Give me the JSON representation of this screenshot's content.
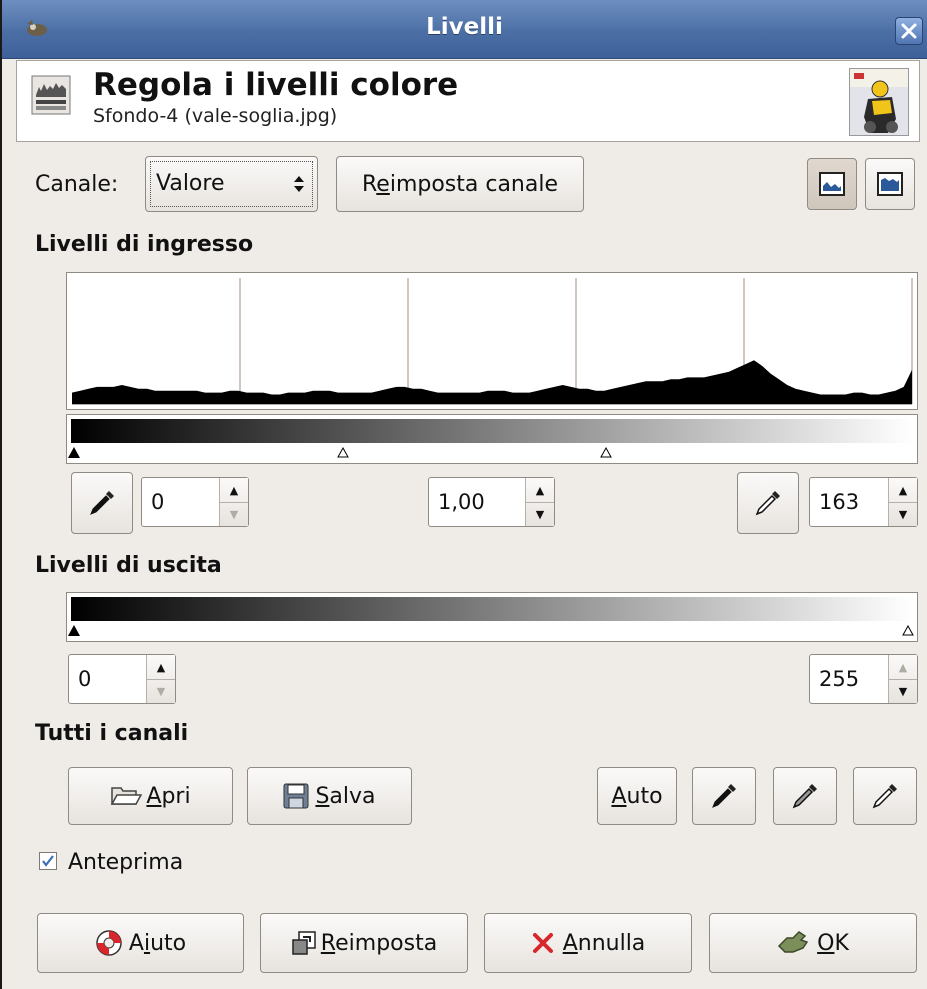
{
  "window": {
    "title": "Livelli"
  },
  "header": {
    "title": "Regola i livelli colore",
    "subtitle": "Sfondo-4 (vale-soglia.jpg)"
  },
  "channel": {
    "label": "Canale:",
    "value": "Valore",
    "reset_label_pre": "R",
    "reset_label_mnemonic": "e",
    "reset_label_post": "imposta canale"
  },
  "input_levels": {
    "title": "Livelli di ingresso",
    "low": "0",
    "gamma": "1,00",
    "high": "163"
  },
  "output_levels": {
    "title": "Livelli di uscita",
    "low": "0",
    "high": "255"
  },
  "all_channels": {
    "title": "Tutti i canali",
    "open_mnemonic": "A",
    "open_rest": "pri",
    "save_mnemonic": "S",
    "save_rest": "alva",
    "auto_mnemonic": "A",
    "auto_rest": "uto"
  },
  "preview": {
    "label": "Anteprima",
    "checked": true
  },
  "footer": {
    "help_pre": "A",
    "help_mnemonic": "i",
    "help_post": "uto",
    "reset_mnemonic": "R",
    "reset_rest": "eimposta",
    "cancel_mnemonic": "A",
    "cancel_rest": "nnulla",
    "ok_mnemonic": "O",
    "ok_rest": "K"
  },
  "colors": {
    "titlebar": "#4b6fa5",
    "background": "#efebe7",
    "cancel_icon": "#d8262d",
    "checkbox": "#3b6fb6"
  },
  "histogram": {
    "values": [
      6,
      7,
      8,
      9,
      9,
      9,
      10,
      9,
      8,
      8,
      7,
      7,
      7,
      7,
      7,
      7,
      6,
      6,
      6,
      7,
      7,
      6,
      6,
      6,
      5,
      5,
      6,
      6,
      6,
      7,
      7,
      7,
      6,
      6,
      6,
      6,
      6,
      7,
      8,
      9,
      9,
      8,
      8,
      7,
      6,
      6,
      6,
      6,
      6,
      6,
      7,
      7,
      7,
      6,
      6,
      6,
      7,
      8,
      9,
      10,
      9,
      8,
      8,
      7,
      7,
      8,
      9,
      10,
      11,
      12,
      12,
      12,
      13,
      13,
      14,
      14,
      14,
      15,
      16,
      17,
      19,
      21,
      23,
      20,
      16,
      13,
      10,
      8,
      7,
      6,
      5,
      5,
      5,
      5,
      6,
      6,
      5,
      5,
      6,
      7,
      9,
      18
    ]
  }
}
